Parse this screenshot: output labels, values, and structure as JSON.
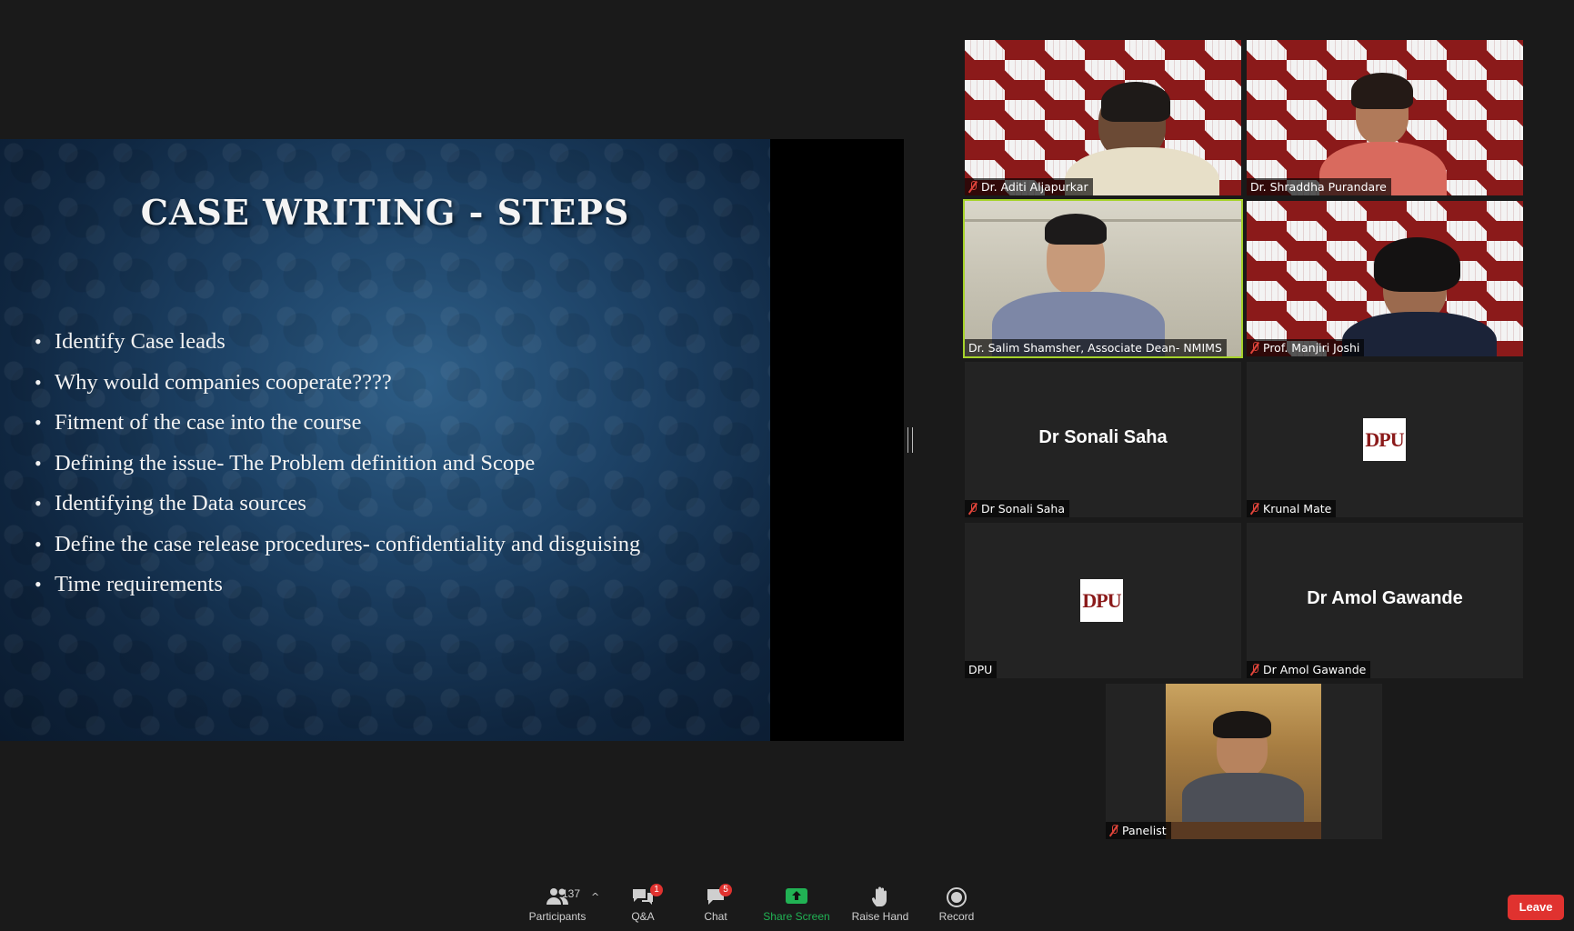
{
  "slide": {
    "title": "CASE WRITING - STEPS",
    "bullets": [
      "Identify Case leads",
      "Why would companies cooperate????",
      "Fitment of the case into the course",
      "Defining the issue- The Problem definition and Scope",
      "Identifying the Data sources",
      "Define the case release procedures- confidentiality and disguising",
      "Time requirements"
    ]
  },
  "tiles": [
    {
      "label": "Dr. Aditi Aljapurkar",
      "muted": true,
      "type": "video"
    },
    {
      "label": "Dr. Shraddha Purandare",
      "muted": false,
      "type": "video"
    },
    {
      "label": "Dr. Salim Shamsher, Associate Dean- NMIMS",
      "muted": false,
      "type": "video",
      "active": true
    },
    {
      "label": "Prof. Manjiri Joshi",
      "muted": true,
      "type": "video"
    },
    {
      "label": "Dr Sonali Saha",
      "muted": true,
      "type": "name",
      "display_name": "Dr Sonali Saha"
    },
    {
      "label": "Krunal Mate",
      "muted": true,
      "type": "logo",
      "logo_text": "DPU"
    },
    {
      "label": "DPU",
      "muted": false,
      "type": "logo",
      "logo_text": "DPU"
    },
    {
      "label": "Dr Amol Gawande",
      "muted": true,
      "type": "name",
      "display_name": "Dr Amol Gawande"
    },
    {
      "label": "Panelist",
      "muted": true,
      "type": "video"
    }
  ],
  "toolbar": {
    "participants_label": "Participants",
    "participants_count": "137",
    "qa_label": "Q&A",
    "qa_badge": "1",
    "chat_label": "Chat",
    "chat_badge": "5",
    "share_label": "Share Screen",
    "raise_label": "Raise Hand",
    "record_label": "Record",
    "leave_label": "Leave"
  },
  "colors": {
    "share_green": "#21b254",
    "active_speaker": "#a6d32b",
    "leave_red": "#e0322f",
    "brand_maroon": "#8b1a1a"
  }
}
